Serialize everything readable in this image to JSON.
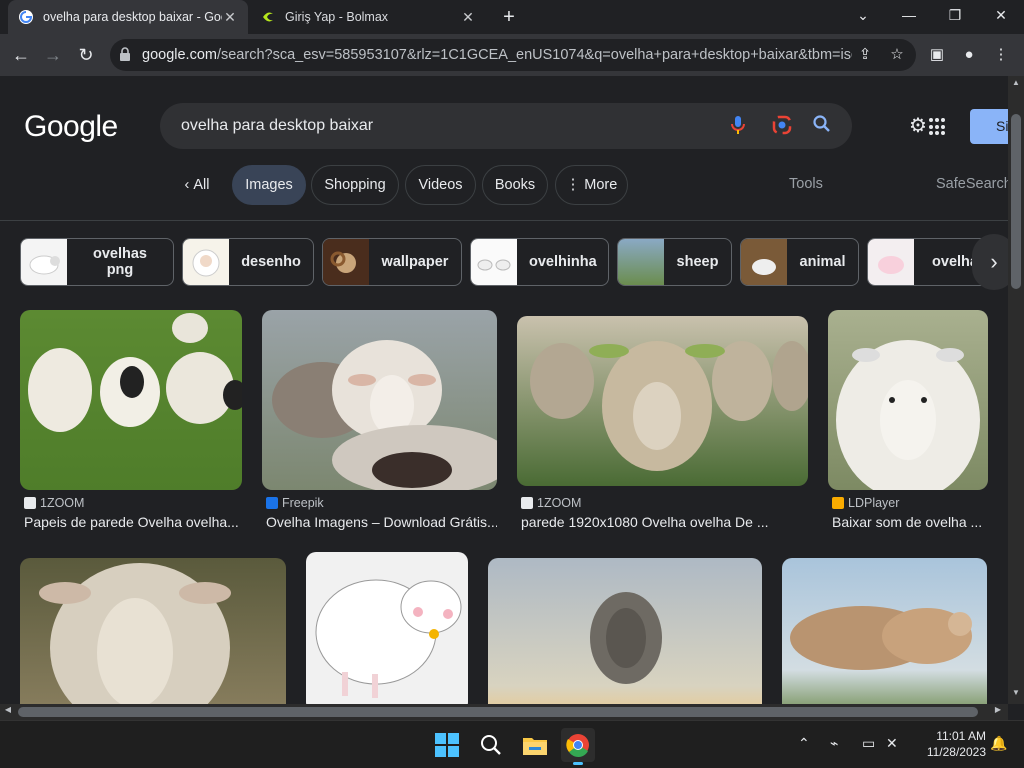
{
  "browser": {
    "tabs": [
      {
        "title": "ovelha para desktop baixar - Goo",
        "active": true
      },
      {
        "title": "Giriş Yap - Bolmax",
        "active": false
      }
    ],
    "new_tab_icon": "+",
    "url_host": "google.com",
    "url_rest": "/search?sca_esv=585953107&rlz=1C1GCEA_enUS1074&q=ovelha+para+desktop+baixar&tbm=isch...",
    "window_controls": [
      "chevron-down",
      "minimize",
      "restore",
      "close"
    ]
  },
  "google": {
    "logo": "Google",
    "query": "ovelha para desktop baixar",
    "signin_label": "Si",
    "filters": [
      {
        "label": "All",
        "selected": false
      },
      {
        "label": "Images",
        "selected": true
      },
      {
        "label": "Shopping",
        "selected": false
      },
      {
        "label": "Videos",
        "selected": false
      },
      {
        "label": "Books",
        "selected": false
      },
      {
        "label": "More",
        "selected": false
      }
    ],
    "tools_label": "Tools",
    "safesearch_label": "SafeSearch",
    "chips": [
      "ovelhas png",
      "desenho",
      "wallpaper",
      "ovelhinha",
      "sheep",
      "animal",
      "ovelha"
    ],
    "results_row1": [
      {
        "source": "1ZOOM",
        "caption": "Papeis de parede Ovelha ovelha..."
      },
      {
        "source": "Freepik",
        "caption": "Ovelha Imagens – Download Grátis..."
      },
      {
        "source": "1ZOOM",
        "caption": "parede 1920x1080 Ovelha ovelha De ..."
      },
      {
        "source": "LDPlayer",
        "caption": "Baixar som de ovelha ..."
      }
    ]
  },
  "taskbar": {
    "time": "11:01 AM",
    "date": "11/28/2023",
    "apps": [
      "windows-start",
      "search",
      "file-explorer",
      "chrome"
    ]
  },
  "colors": {
    "page_bg": "#202124",
    "accent": "#8ab4f8",
    "selected_pill": "#394457"
  }
}
